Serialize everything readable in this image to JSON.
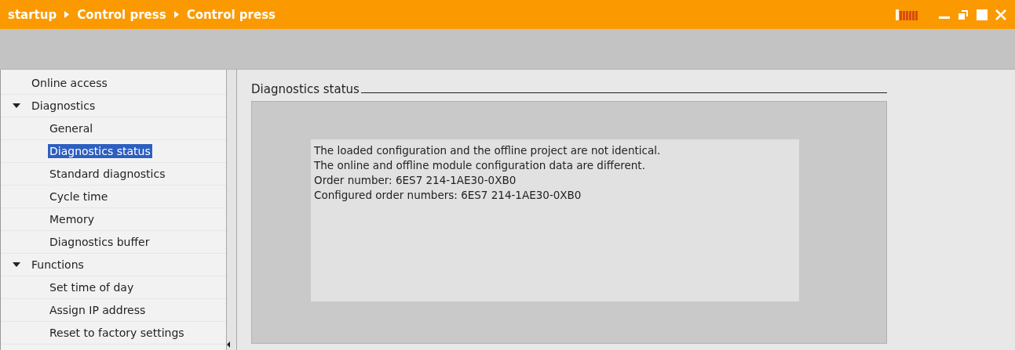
{
  "title_bar": {
    "breadcrumb": [
      "startup",
      "Control press",
      "Control press"
    ]
  },
  "sidebar": {
    "items": [
      {
        "label": "Online access",
        "selected": false
      },
      {
        "label": "Diagnostics",
        "selected": false,
        "expanded": true,
        "children": [
          {
            "label": "General",
            "selected": false
          },
          {
            "label": "Diagnostics status",
            "selected": true
          },
          {
            "label": "Standard diagnostics",
            "selected": false
          },
          {
            "label": "Cycle time",
            "selected": false
          },
          {
            "label": "Memory",
            "selected": false
          },
          {
            "label": "Diagnostics buffer",
            "selected": false
          }
        ]
      },
      {
        "label": "Functions",
        "selected": false,
        "expanded": true,
        "children": [
          {
            "label": "Set time of day",
            "selected": false
          },
          {
            "label": "Assign IP address",
            "selected": false
          },
          {
            "label": "Reset to factory settings",
            "selected": false
          }
        ]
      }
    ]
  },
  "content": {
    "section_title": "Diagnostics status",
    "messages": [
      "The loaded configuration and the offline project are not identical.",
      "The online and offline module configuration data are different.",
      "Order number:  6ES7 214-1AE30-0XB0",
      "Configured order numbers:  6ES7 214-1AE30-0XB0"
    ]
  }
}
